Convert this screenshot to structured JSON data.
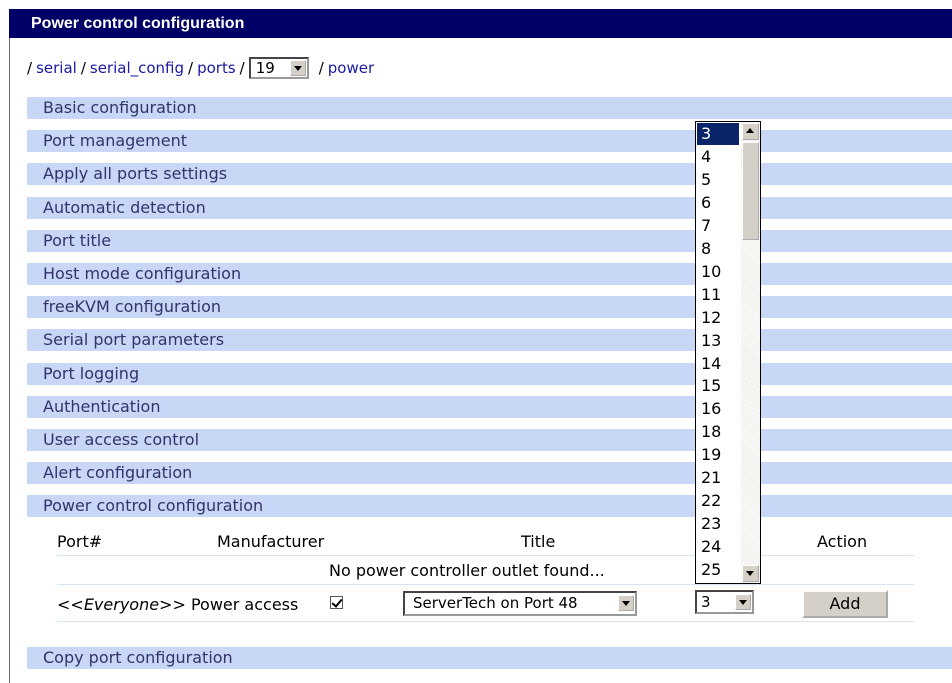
{
  "title": "Power control configuration",
  "breadcrumb": {
    "serial": "serial",
    "serial_config": "serial_config",
    "ports": "ports",
    "port_value": "19",
    "power": "power",
    "separator": "/"
  },
  "sections": [
    "Basic configuration",
    "Port management",
    "Apply all ports settings",
    "Automatic detection",
    "Port title",
    "Host mode configuration",
    "freeKVM configuration",
    "Serial port parameters",
    "Port logging",
    "Authentication",
    "User access control",
    "Alert configuration",
    "Power control configuration"
  ],
  "table": {
    "headers": {
      "port": "Port#",
      "manufacturer": "Manufacturer",
      "title": "Title",
      "action": "Action"
    },
    "empty_message": "No power controller outlet found...",
    "access_row": {
      "everyone": "<<Everyone>>",
      "label": " Power access",
      "checked": true,
      "controller": "ServerTech on Port 48",
      "outlet": "3",
      "add_label": "Add"
    }
  },
  "outlet_options": [
    "3",
    "4",
    "5",
    "6",
    "7",
    "8",
    "10",
    "11",
    "12",
    "13",
    "14",
    "15",
    "16",
    "18",
    "19",
    "21",
    "22",
    "23",
    "24",
    "25"
  ],
  "outlet_selected_index": 0,
  "footer_section": "Copy port configuration",
  "colors": {
    "title_bg": "#000066",
    "section_bg": "#c7d7f5",
    "link": "#1a1aa6",
    "selected": "#0a246a"
  }
}
